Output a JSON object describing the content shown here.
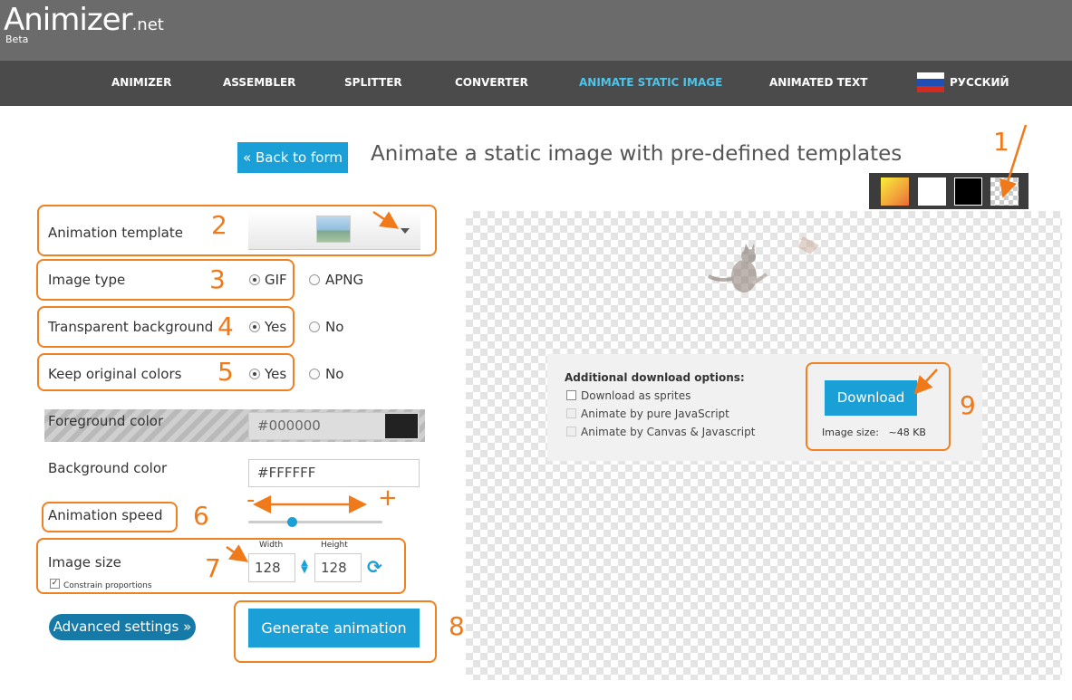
{
  "app": {
    "logo_text": "Animizer",
    "logo_suffix": ".net",
    "beta": "Beta"
  },
  "nav": {
    "items": [
      "ANIMIZER",
      "ASSEMBLER",
      "SPLITTER",
      "CONVERTER",
      "ANIMATE STATIC IMAGE",
      "ANIMATED TEXT"
    ],
    "active": "ANIMATE STATIC IMAGE",
    "language": "РУССКИЙ"
  },
  "header": {
    "back_button": "« Back to form",
    "title": "Animate a static image with pre-defined templates"
  },
  "background_swatches": [
    "gradient-yellow",
    "white",
    "black",
    "transparent"
  ],
  "form": {
    "animation_template_label": "Animation template",
    "image_type_label": "Image type",
    "image_type_options": [
      "GIF",
      "APNG"
    ],
    "image_type_selected": "GIF",
    "transparent_bg_label": "Transparent background",
    "transparent_bg_options": [
      "Yes",
      "No"
    ],
    "transparent_bg_selected": "Yes",
    "keep_colors_label": "Keep original colors",
    "keep_colors_options": [
      "Yes",
      "No"
    ],
    "keep_colors_selected": "Yes",
    "foreground_label": "Foreground color",
    "foreground_value": "#000000",
    "background_label": "Background color",
    "background_value": "#FFFFFF",
    "speed_label": "Animation speed",
    "speed_level": 0.3,
    "image_size_label": "Image size",
    "width_label": "Width",
    "height_label": "Height",
    "width_value": "128",
    "height_value": "128",
    "constrain_label": "Constrain proportions",
    "constrain_checked": true,
    "advanced_button": "Advanced settings »",
    "generate_button": "Generate animation"
  },
  "download": {
    "title": "Additional download options:",
    "options": [
      "Download as sprites",
      "Animate by pure JavaScript",
      "Animate by Canvas & Javascript"
    ],
    "button": "Download",
    "size_label": "Image size:",
    "size_value": "~48 KB"
  },
  "annotations": {
    "numbers": [
      "1",
      "2",
      "3",
      "4",
      "5",
      "6",
      "7",
      "8",
      "9"
    ],
    "minus": "-",
    "plus": "+",
    "color": "#f07a1a"
  },
  "colors": {
    "accent": "#1a9fd6",
    "header": "#6b6b6b",
    "nav": "#4b4b4b",
    "nav_active": "#4fc3e8"
  }
}
